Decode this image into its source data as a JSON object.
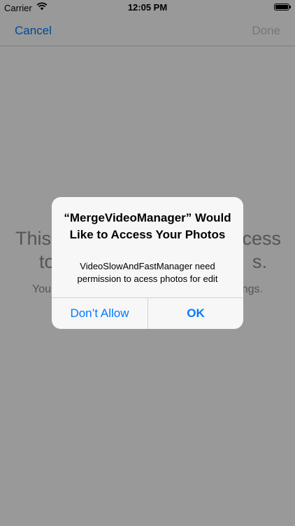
{
  "status_bar": {
    "carrier": "Carrier",
    "time": "12:05 PM",
    "wifi_icon": "wifi-icon",
    "battery_icon": "battery-icon"
  },
  "nav": {
    "cancel_label": "Cancel",
    "done_label": "Done"
  },
  "content": {
    "headline_visible_fragments": [
      "This",
      "cess",
      "to",
      "s."
    ],
    "subline_visible_fragments": [
      "You",
      "ngs."
    ]
  },
  "alert": {
    "title": "“MergeVideoManager” Would Like to Access Your Photos",
    "message": "VideoSlowAndFastManager need permission to acess photos for edit",
    "dont_allow_label": "Don’t Allow",
    "ok_label": "OK"
  },
  "colors": {
    "accent": "#007aff",
    "disabled": "#c7c7cc",
    "background_text": "#8e8e93"
  }
}
